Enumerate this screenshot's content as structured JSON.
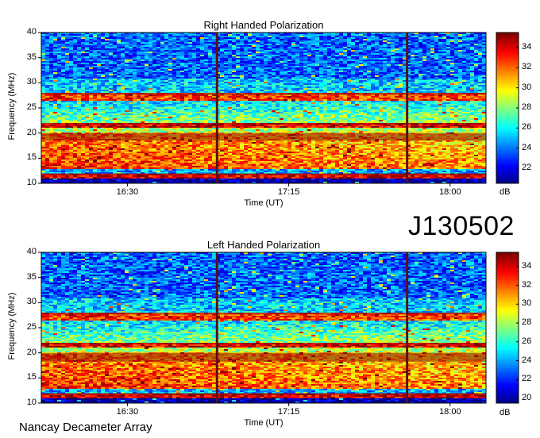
{
  "chart_data": [
    {
      "type": "heatmap",
      "title": "Right Handed Polarization",
      "xlabel": "Time (UT)",
      "ylabel": "Frequency (MHz)",
      "xticks": [
        "16:30",
        "17:15",
        "18:00"
      ],
      "yticks": [
        10,
        15,
        20,
        25,
        30,
        35,
        40
      ],
      "ylim": [
        10,
        40
      ],
      "colorbar": {
        "label": "dB",
        "ticks": [
          22,
          24,
          26,
          28,
          30,
          32,
          34
        ],
        "range": [
          20.5,
          35.5
        ]
      },
      "intense_bands_mhz": [
        [
          10.5,
          12
        ],
        [
          14,
          20
        ],
        [
          21,
          22
        ],
        [
          26.5,
          28
        ]
      ],
      "vertical_lines_time": [
        "16:55",
        "17:48"
      ]
    },
    {
      "type": "heatmap",
      "title": "Left Handed Polarization",
      "xlabel": "Time (UT)",
      "ylabel": "Frequency (MHz)",
      "xticks": [
        "16:30",
        "17:15",
        "18:00"
      ],
      "yticks": [
        10,
        15,
        20,
        25,
        30,
        35,
        40
      ],
      "ylim": [
        10,
        40
      ],
      "colorbar": {
        "label": "dB",
        "ticks": [
          20,
          22,
          24,
          26,
          28,
          30,
          32,
          34
        ],
        "range": [
          19.5,
          35.5
        ]
      },
      "intense_bands_mhz": [
        [
          10.5,
          12
        ],
        [
          13,
          20
        ],
        [
          21,
          22
        ],
        [
          26.5,
          28
        ]
      ],
      "vertical_lines_time": [
        "16:55",
        "17:48"
      ]
    }
  ],
  "event_id": "J130502",
  "footer": "Nancay Decameter Array",
  "colors": {
    "low": "#00008f",
    "mid": "#7fff7f",
    "high": "#800000"
  }
}
